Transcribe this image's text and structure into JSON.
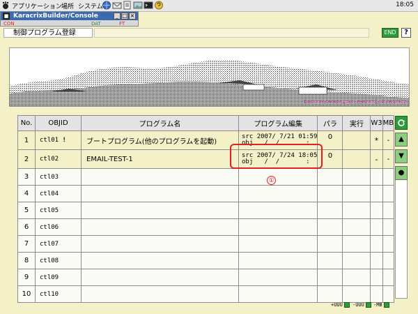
{
  "panel": {
    "menu": [
      "アプリケーション",
      "場所",
      "システム"
    ],
    "clock": "18:05"
  },
  "console": {
    "title": "KaracrixBuilder/Console",
    "toolbar": [
      "CON",
      "DAT",
      "FT"
    ]
  },
  "header": {
    "title": "制御プログラム登録",
    "end_label": "END",
    "help_label": "?"
  },
  "banner": {
    "credit": "KanbaraYorunoyuki(eyohan)/Hiroshige"
  },
  "table": {
    "columns": [
      "No.",
      "OBJID",
      "プログラム名",
      "プログラム編集",
      "パラ",
      "実行",
      "W3",
      "MB"
    ],
    "rows": [
      {
        "no": "1",
        "objid": "ctl01",
        "mark": "!",
        "name": "ブートプログラム(他のプログラムを起動)",
        "src_label": "src",
        "src_time": "2007/ 7/21 01:59",
        "obj_label": "obj",
        "obj_time": "  /  /       :",
        "para": "0",
        "exec": "",
        "w3": "*",
        "mb": "-"
      },
      {
        "no": "2",
        "objid": "ctl02",
        "mark": "",
        "name": "EMAIL-TEST-1",
        "src_label": "src",
        "src_time": "2007/ 7/24 18:05",
        "obj_label": "obj",
        "obj_time": "  /  /       :",
        "para": "0",
        "exec": "",
        "w3": "-",
        "mb": "-"
      },
      {
        "no": "3",
        "objid": "ctl03",
        "mark": "",
        "name": "",
        "src_label": "",
        "src_time": "",
        "obj_label": "",
        "obj_time": "",
        "para": "",
        "exec": "",
        "w3": "",
        "mb": ""
      },
      {
        "no": "4",
        "objid": "ctl04",
        "mark": "",
        "name": "",
        "src_label": "",
        "src_time": "",
        "obj_label": "",
        "obj_time": "",
        "para": "",
        "exec": "",
        "w3": "",
        "mb": ""
      },
      {
        "no": "5",
        "objid": "ctl05",
        "mark": "",
        "name": "",
        "src_label": "",
        "src_time": "",
        "obj_label": "",
        "obj_time": "",
        "para": "",
        "exec": "",
        "w3": "",
        "mb": ""
      },
      {
        "no": "6",
        "objid": "ctl06",
        "mark": "",
        "name": "",
        "src_label": "",
        "src_time": "",
        "obj_label": "",
        "obj_time": "",
        "para": "",
        "exec": "",
        "w3": "",
        "mb": ""
      },
      {
        "no": "7",
        "objid": "ctl07",
        "mark": "",
        "name": "",
        "src_label": "",
        "src_time": "",
        "obj_label": "",
        "obj_time": "",
        "para": "",
        "exec": "",
        "w3": "",
        "mb": ""
      },
      {
        "no": "8",
        "objid": "ctl08",
        "mark": "",
        "name": "",
        "src_label": "",
        "src_time": "",
        "obj_label": "",
        "obj_time": "",
        "para": "",
        "exec": "",
        "w3": "",
        "mb": ""
      },
      {
        "no": "9",
        "objid": "ctl09",
        "mark": "",
        "name": "",
        "src_label": "",
        "src_time": "",
        "obj_label": "",
        "obj_time": "",
        "para": "",
        "exec": "",
        "w3": "",
        "mb": ""
      },
      {
        "no": "10",
        "objid": "ctl10",
        "mark": "",
        "name": "",
        "src_label": "",
        "src_time": "",
        "obj_label": "",
        "obj_time": "",
        "para": "",
        "exec": "",
        "w3": "",
        "mb": ""
      }
    ]
  },
  "side": {
    "refresh_icon": "refresh-icon",
    "up_label": "▲",
    "down_label": "▼",
    "dot_label": "●"
  },
  "annotation": {
    "number": "①",
    "color": "#e02020"
  },
  "footer": {
    "buttons": [
      "+UUU",
      "-UUU",
      "-MB"
    ]
  },
  "colors": {
    "background": "#f4f1c9",
    "accent_green": "#2e9a3a",
    "annotation_red": "#e02020"
  }
}
